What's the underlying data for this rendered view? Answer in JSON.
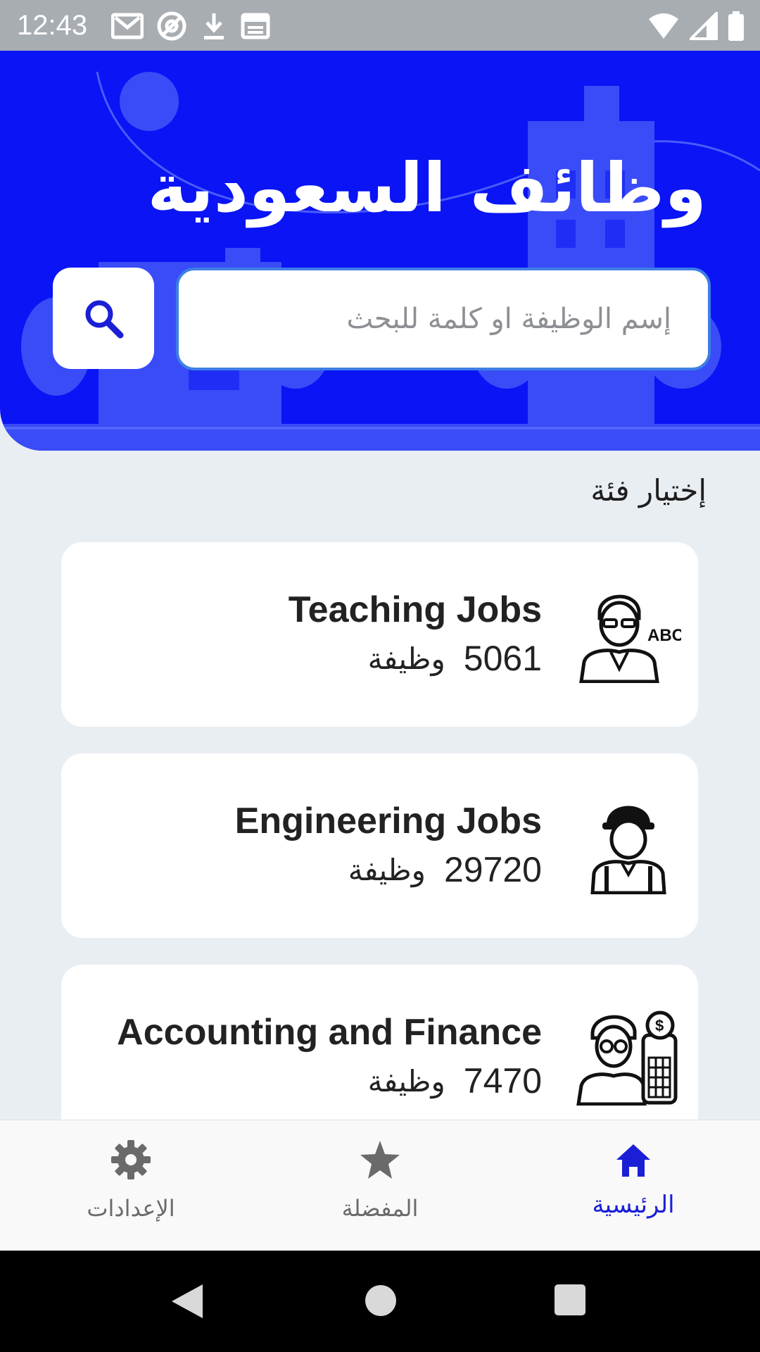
{
  "status_bar": {
    "time": "12:43",
    "left_icons": [
      "gmail-icon",
      "at-sign-icon",
      "download-icon",
      "calendar-icon"
    ],
    "right_icons": [
      "wifi-icon",
      "signal-icon",
      "battery-icon"
    ]
  },
  "header": {
    "title": "وظائف السعودية",
    "background_color": "#0a14f5",
    "search": {
      "placeholder": "إسم الوظيفة او كلمة للبحث",
      "value": ""
    }
  },
  "section_title": "إختيار فئة",
  "categories": [
    {
      "title": "Teaching Jobs",
      "count": "5061",
      "unit": "وظيفة",
      "icon": "teacher-icon",
      "icon_badge": "ABC"
    },
    {
      "title": "Engineering Jobs",
      "count": "29720",
      "unit": "وظيفة",
      "icon": "engineer-icon"
    },
    {
      "title": "Accounting and Finance",
      "count": "7470",
      "unit": "وظيفة",
      "icon": "accountant-icon"
    }
  ],
  "bottom_nav": [
    {
      "label": "الرئيسية",
      "icon": "home-icon",
      "active": true
    },
    {
      "label": "المفضلة",
      "icon": "star-icon",
      "active": false
    },
    {
      "label": "الإعدادات",
      "icon": "gear-icon",
      "active": false
    }
  ],
  "colors": {
    "accent": "#1a1fd6",
    "inactive": "#6a6a6a",
    "page_background": "#e9eef3"
  },
  "android_nav": [
    "back-icon",
    "home-circle-icon",
    "recents-icon"
  ]
}
